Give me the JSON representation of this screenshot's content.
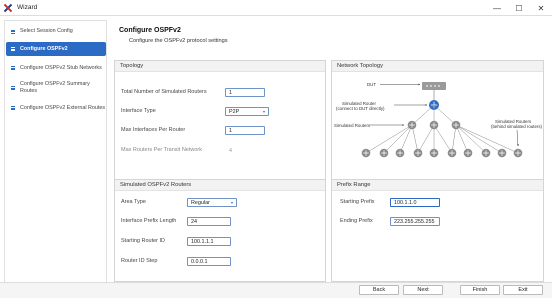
{
  "window": {
    "title": "Wizard",
    "minimize": "—",
    "maximize": "☐",
    "close": "✕"
  },
  "sidebar": {
    "items": [
      {
        "label": "Select Session Config"
      },
      {
        "label": "Configure OSPFv2"
      },
      {
        "label": "Configure OSPFv2 Stub Networks"
      },
      {
        "label": "Configure OSPFv2 Summary Routes"
      },
      {
        "label": "Configure OSPFv2 External Routes"
      }
    ]
  },
  "header": {
    "title": "Configure OSPFv2",
    "subtitle": "Configure the OSPFv2 protocol settings"
  },
  "topology": {
    "title": "Topology",
    "num_routers_label": "Total Number of Simulated Routers",
    "num_routers_value": "1",
    "interface_type_label": "Interface Type",
    "interface_type_value": "P2P",
    "max_interfaces_label": "Max Interfaces Per Router",
    "max_interfaces_value": "1",
    "max_routers_transit_label": "Max Routers Per Transit Network",
    "max_routers_transit_value": "4"
  },
  "network_topology": {
    "title": "Network Topology",
    "dut_label": "DUT",
    "simulated_router_label_1": "Simulated Router",
    "simulated_router_label_2": "(connect to DUT directly)",
    "simulated_routers_label": "Simulated Routers",
    "behind_label_1": "Simulated Routers",
    "behind_label_2": "(behind simulated routers)"
  },
  "simulated_routers": {
    "title": "Simulated OSPFv2 Routers",
    "area_type_label": "Area Type",
    "area_type_value": "Regular",
    "prefix_length_label": "Interface Prefix Length",
    "prefix_length_value": "24",
    "starting_router_id_label": "Starting Router ID",
    "starting_router_id_value": "100.1.1.1",
    "router_id_step_label": "Router ID Step",
    "router_id_step_value": "0.0.0.1"
  },
  "prefix_range": {
    "title": "Prefix Range",
    "starting_prefix_label": "Starting Prefix",
    "starting_prefix_value": "100.1.1.0",
    "ending_prefix_label": "Ending Prefix",
    "ending_prefix_value": "223.255.255.255"
  },
  "footer": {
    "back": "Back",
    "next": "Next",
    "finish": "Finish",
    "exit": "Exit"
  },
  "colors": {
    "accent": "#2c6bc5",
    "router": "#8a8a8a",
    "dut": "#9a9a9a"
  },
  "icons": [
    "app-logo-icon",
    "menu-lines-icon",
    "chevron-down-icon",
    "router-icon",
    "dut-device-icon",
    "arrow-icon"
  ]
}
